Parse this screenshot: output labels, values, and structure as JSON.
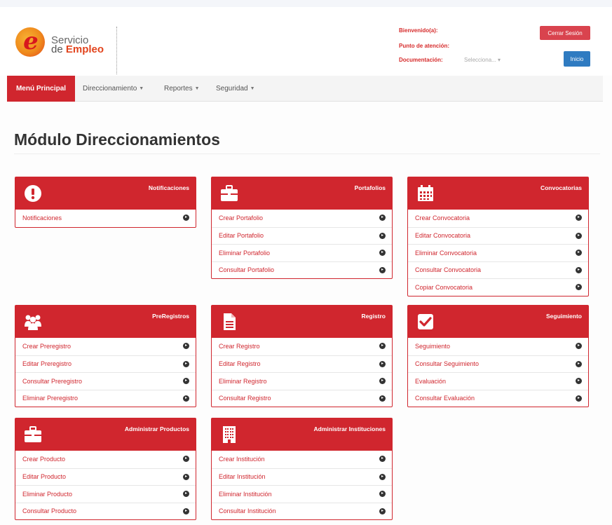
{
  "header": {
    "logo_line1": "Servicio",
    "logo_prefix": "de ",
    "logo_highlight": "Empleo",
    "bienvenido_label": "Bienvenido(a):",
    "punto_label": "Punto de atención:",
    "documentacion_label": "Documentación:",
    "documentacion_select": "Selecciona...",
    "logout_label": "Cerrar Sesión",
    "inicio_label": "Inicio"
  },
  "nav": {
    "items": [
      {
        "label": "Menú Principal",
        "active": true
      },
      {
        "label": "Direccionamiento",
        "dropdown": true
      },
      {
        "label": "Reportes",
        "dropdown": true
      },
      {
        "label": "Seguridad",
        "dropdown": true
      }
    ]
  },
  "page": {
    "title": "Módulo Direccionamientos"
  },
  "colors": {
    "primary": "#d0262e",
    "link_blue": "#2f7bc1"
  },
  "panels": [
    {
      "title": "Notificaciones",
      "icon": "exclamation-icon",
      "items": [
        "Notificaciones"
      ]
    },
    {
      "title": "Portafolios",
      "icon": "briefcase-icon",
      "items": [
        "Crear Portafolio",
        "Editar Portafolio",
        "Eliminar Portafolio",
        "Consultar Portafolio"
      ]
    },
    {
      "title": "Convocatorias",
      "icon": "calendar-icon",
      "items": [
        "Crear Convocatoria",
        "Editar Convocatoria",
        "Eliminar Convocatoria",
        "Consultar Convocatoria",
        "Copiar Convocatoria"
      ]
    },
    {
      "title": "PreRegistros",
      "icon": "users-icon",
      "items": [
        "Crear Preregistro",
        "Editar Preregistro",
        "Consultar Preregistro",
        "Eliminar Preregistro"
      ]
    },
    {
      "title": "Registro",
      "icon": "document-icon",
      "items": [
        "Crear Registro",
        "Editar Registro",
        "Eliminar Registro",
        "Consultar Registro"
      ]
    },
    {
      "title": "Seguimiento",
      "icon": "checkbox-icon",
      "items": [
        "Seguimiento",
        "Consultar Seguimiento",
        "Evaluación",
        "Consultar Evaluación"
      ]
    },
    {
      "title": "Administrar Productos",
      "icon": "briefcase-icon",
      "items": [
        "Crear Producto",
        "Editar Producto",
        "Eliminar Producto",
        "Consultar Producto"
      ]
    },
    {
      "title": "Administrar Instituciones",
      "icon": "building-icon",
      "items": [
        "Crear Institución",
        "Editar Institución",
        "Eliminar Institución",
        "Consultar Institución"
      ]
    }
  ]
}
